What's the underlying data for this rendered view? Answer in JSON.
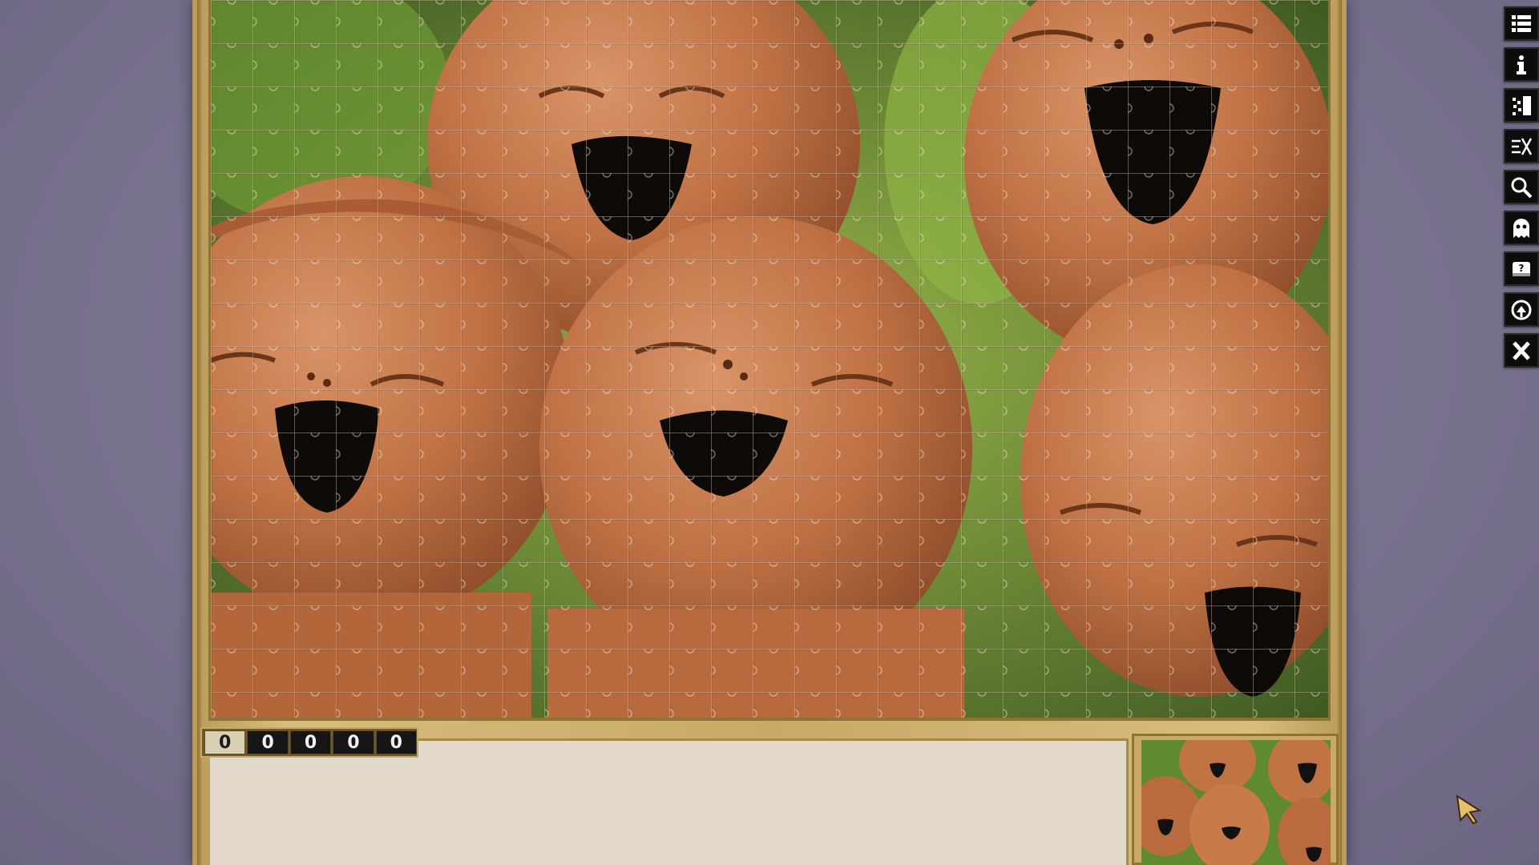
{
  "game": {
    "move_counter": {
      "digits": [
        "0",
        "0",
        "0",
        "0",
        "0"
      ]
    }
  },
  "toolbar": {
    "buttons": [
      {
        "name": "menu",
        "icon": "list-icon"
      },
      {
        "name": "info",
        "icon": "info-icon"
      },
      {
        "name": "scatter-pieces",
        "icon": "scatter-icon"
      },
      {
        "name": "sort-edges",
        "icon": "edges-icon"
      },
      {
        "name": "zoom",
        "icon": "magnifier-icon"
      },
      {
        "name": "ghost-image",
        "icon": "ghost-icon"
      },
      {
        "name": "hint",
        "icon": "hint-box-icon"
      },
      {
        "name": "rotate",
        "icon": "rotate-icon"
      },
      {
        "name": "close",
        "icon": "x-icon"
      }
    ]
  },
  "colors": {
    "frame_gold": "#c9a965",
    "wall": "#7c7590",
    "tray": "#e3d9cb",
    "terracotta": "#c07444"
  }
}
